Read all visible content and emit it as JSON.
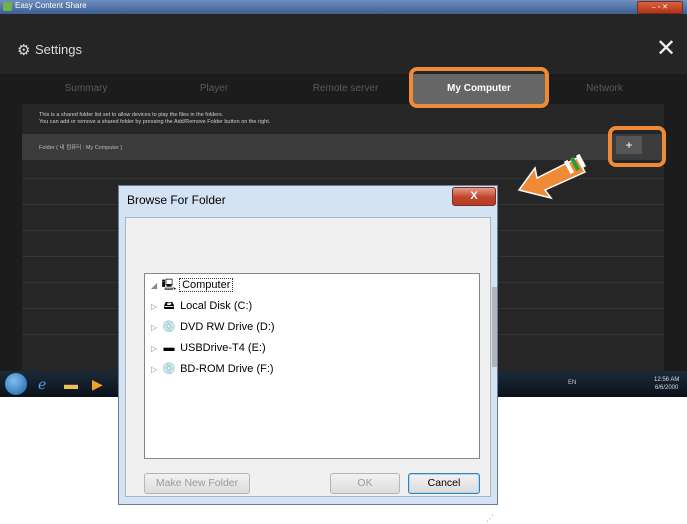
{
  "window": {
    "title": "Easy Content Share",
    "controls": "– ▫ ✕"
  },
  "settings": {
    "title": "Settings",
    "close": "✕"
  },
  "tabs": [
    {
      "label": "Summary",
      "active": false
    },
    {
      "label": "Player",
      "active": false
    },
    {
      "label": "Remote server",
      "active": false
    },
    {
      "label": "My Computer",
      "active": true
    },
    {
      "label": "Network",
      "active": false
    }
  ],
  "info": {
    "line1": "This is a shared folder list set to allow devices to play the files in the folders.",
    "line2": "You can add or remove a shared folder by pressing the Add/Remove Folder button on the right."
  },
  "folder_header": "Folder  ( 내 컴퓨터 : My Computer )",
  "add_button": "+",
  "taskbar": {
    "tray": "EN",
    "time": "12:56 AM",
    "date": "6/6/2000"
  },
  "dialog": {
    "title": "Browse For Folder",
    "close": "X",
    "tree": [
      {
        "label": "Computer",
        "icon": "computer-icon"
      },
      {
        "label": "Local Disk (C:)",
        "icon": "local-disk-icon"
      },
      {
        "label": "DVD RW Drive (D:)",
        "icon": "dvd-drive-icon"
      },
      {
        "label": "USBDrive-T4 (E:)",
        "icon": "usb-drive-icon"
      },
      {
        "label": "BD-ROM Drive (F:)",
        "icon": "bd-drive-icon"
      }
    ],
    "make_new_folder": "Make New Folder",
    "ok": "OK",
    "cancel": "Cancel"
  },
  "colors": {
    "accent_orange": "#ef8a36",
    "app_bg": "#1c1c1c",
    "dialog_frame": "#d4e3f4"
  }
}
